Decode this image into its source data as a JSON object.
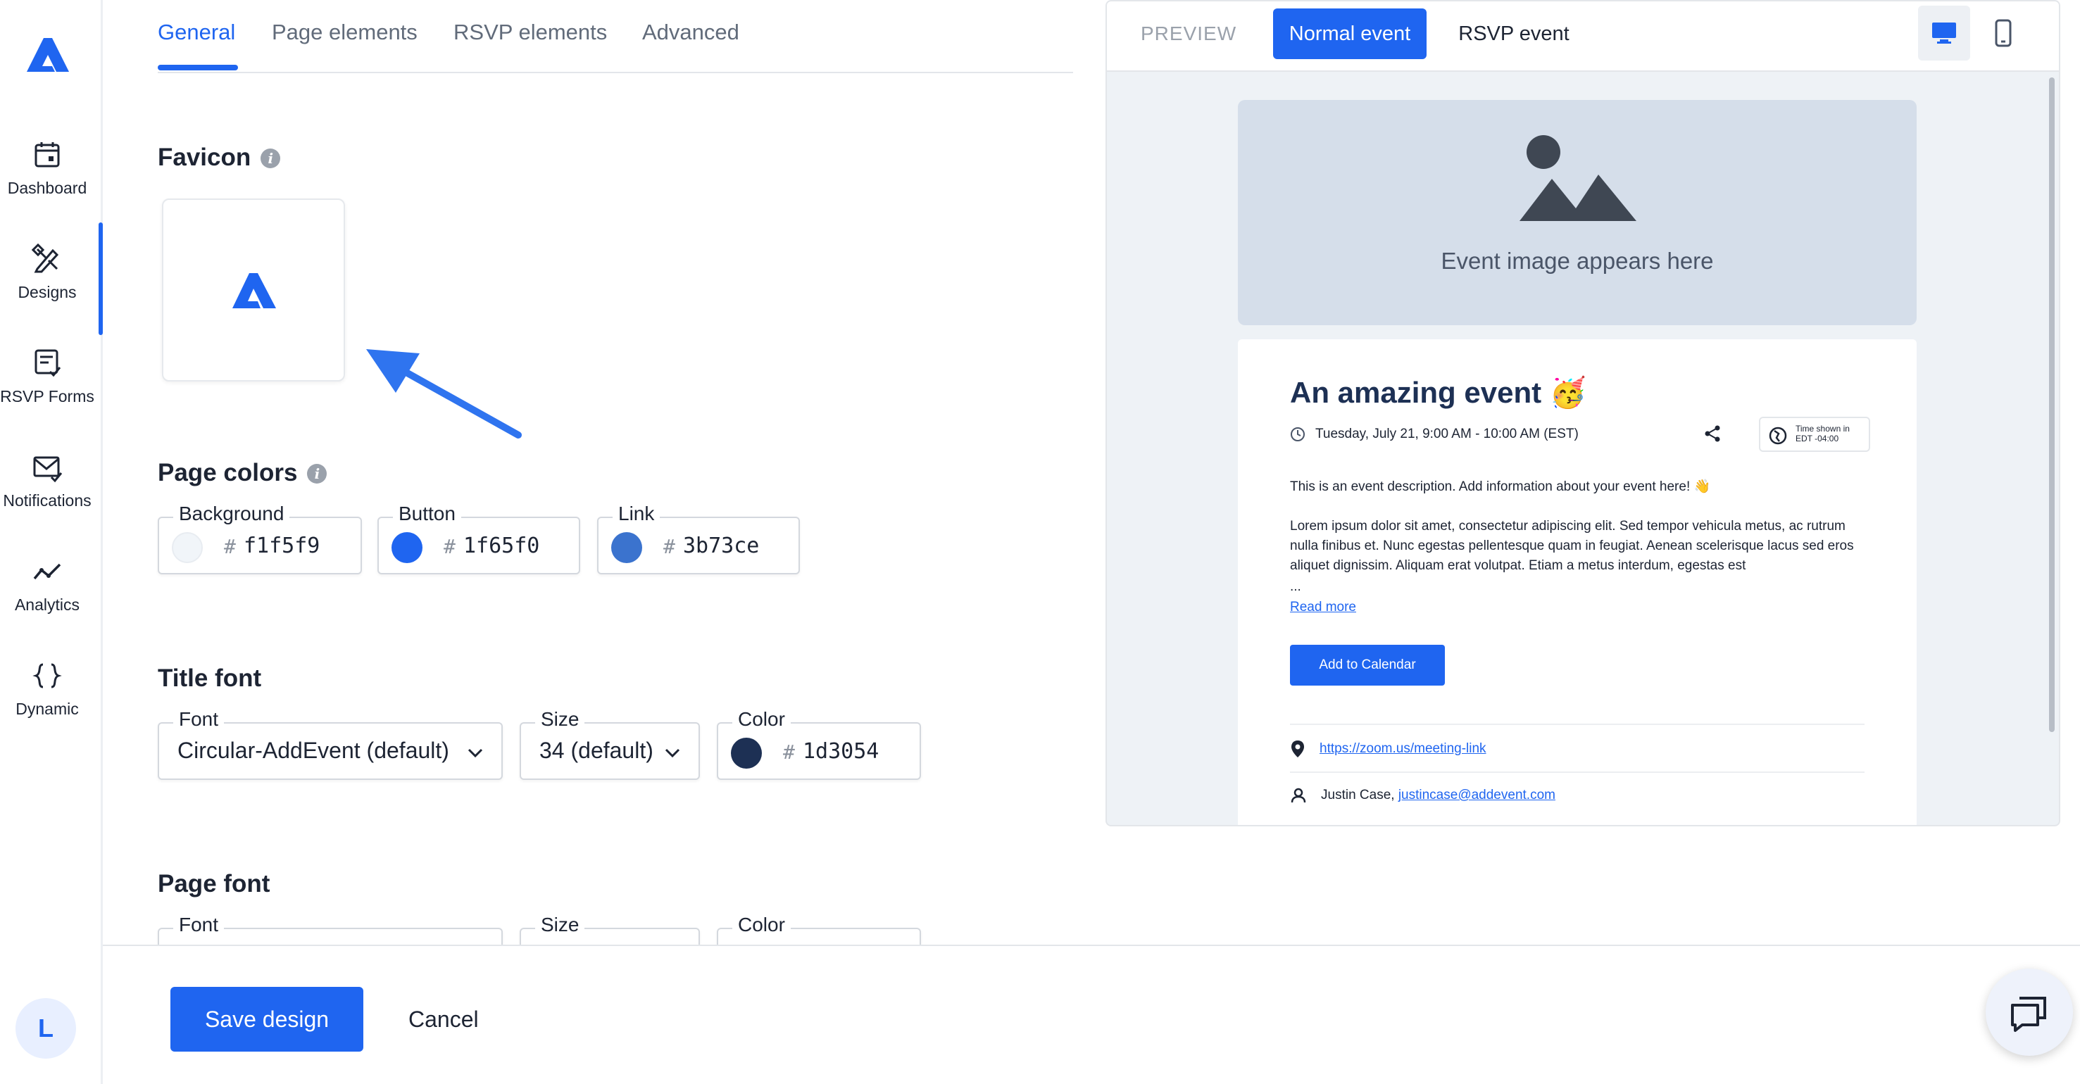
{
  "sidebar": {
    "items": [
      {
        "label": "Dashboard",
        "icon": "calendar-icon"
      },
      {
        "label": "Designs",
        "icon": "designs-tools-icon"
      },
      {
        "label": "RSVP Forms",
        "icon": "form-check-icon"
      },
      {
        "label": "Notifications",
        "icon": "mail-check-icon"
      },
      {
        "label": "Analytics",
        "icon": "line-chart-icon"
      },
      {
        "label": "Dynamic",
        "icon": "braces-icon"
      }
    ],
    "active_index": 1,
    "avatar_initial": "L"
  },
  "tabs": [
    {
      "label": "General",
      "active": true
    },
    {
      "label": "Page elements",
      "active": false
    },
    {
      "label": "RSVP elements",
      "active": false
    },
    {
      "label": "Advanced",
      "active": false
    }
  ],
  "favicon": {
    "title": "Favicon",
    "info": "i"
  },
  "page_colors": {
    "title": "Page colors",
    "fields": [
      {
        "label": "Background",
        "hash": "#",
        "hex": "f1f5f9",
        "color": "#f1f5f9"
      },
      {
        "label": "Button",
        "hash": "#",
        "hex": "1f65f0",
        "color": "#1f65f0"
      },
      {
        "label": "Link",
        "hash": "#",
        "hex": "3b73ce",
        "color": "#3b73ce"
      }
    ]
  },
  "title_font": {
    "title": "Title font",
    "font_label": "Font",
    "font_value": "Circular-AddEvent (default)",
    "size_label": "Size",
    "size_value": "34 (default)",
    "color_label": "Color",
    "color_hash": "#",
    "color_hex": "1d3054",
    "color": "#1d3054"
  },
  "page_font": {
    "title": "Page font",
    "font_label": "Font",
    "size_label": "Size",
    "color_label": "Color"
  },
  "actions": {
    "save": "Save design",
    "cancel": "Cancel"
  },
  "preview": {
    "label": "PREVIEW",
    "normal_event": "Normal event",
    "rsvp_event": "RSVP event",
    "image_placeholder": "Event image appears here",
    "event": {
      "title": "An amazing event",
      "emoji": "🥳",
      "datetime": "Tuesday, July 21, 9:00 AM - 10:00 AM (EST)",
      "tz_line1": "Time shown in",
      "tz_line2": "EDT -04:00",
      "desc1": "This is an event description. Add information about your event here! 👋",
      "desc2": "Lorem ipsum dolor sit amet, consectetur adipiscing elit. Sed tempor vehicula metus, ac rutrum nulla finibus et. Nunc egestas pellentesque quam in feugiat. Aenean scelerisque lacus sed eros aliquet dignissim. Aliquam erat volutpat. Etiam a metus interdum, egestas est",
      "ellipsis": "...",
      "read_more": "Read more",
      "add_to_calendar": "Add to Calendar",
      "location_link": "https://zoom.us/meeting-link",
      "organizer_name": "Justin Case,",
      "organizer_email": "justincase@addevent.com"
    }
  },
  "colors": {
    "accent": "#1f65f0",
    "title": "#1d3054"
  }
}
